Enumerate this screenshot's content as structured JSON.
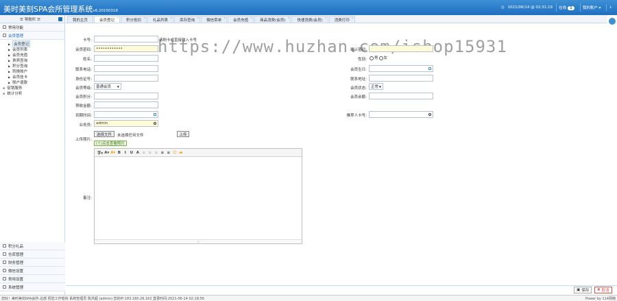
{
  "app": {
    "title": "美时美刻SPA会所管理系统",
    "version": "v6.20150318"
  },
  "topbar": {
    "datetime": "2021/06/14 @ 02:31:19",
    "online_label": "在线",
    "online_count": "1",
    "account_label": "我的账户 ▾",
    "down_icon": "↓"
  },
  "sidebar": {
    "header": "导航栏",
    "sections_top": [
      {
        "label": "常用功能",
        "icon": "grid-icon"
      },
      {
        "label": "会员管理",
        "icon": "grid-icon"
      }
    ],
    "tree": [
      {
        "label": "会员登记",
        "lvl": 1,
        "sel": true
      },
      {
        "label": "会员列表",
        "lvl": 1
      },
      {
        "label": "会员充值",
        "lvl": 1
      },
      {
        "label": "贵宾查询",
        "lvl": 1
      },
      {
        "label": "积分查询",
        "lvl": 1
      },
      {
        "label": "转换账户",
        "lvl": 1
      },
      {
        "label": "会员挂卡",
        "lvl": 1
      },
      {
        "label": "账户退款",
        "lvl": 1
      },
      {
        "label": "促销服务",
        "lvl": 0
      },
      {
        "label": "统计分析",
        "lvl": 0
      }
    ],
    "sections_bottom": [
      {
        "label": "积分礼品"
      },
      {
        "label": "仓库管理"
      },
      {
        "label": "财务管理"
      },
      {
        "label": "微信设置"
      },
      {
        "label": "常用设置"
      },
      {
        "label": "系统管理"
      }
    ]
  },
  "tabs": [
    "我的主页",
    "会员登记",
    "积分抵扣",
    "礼品列表",
    "库存查询",
    "微信菜单",
    "会员充值",
    "商品消费(会员)",
    "快速消费(会员)",
    "消费打印"
  ],
  "form": {
    "card_no": {
      "label": "卡号:",
      "hint": "请刷卡或直接输入卡号"
    },
    "password": {
      "label": "会员密码:",
      "value": "••••••••••••"
    },
    "name": {
      "label": "姓名:"
    },
    "phone": {
      "label": "联系电话:"
    },
    "sfz": {
      "label": "身份证号:"
    },
    "level": {
      "label": "会员等级:",
      "value": "普通会员"
    },
    "initial_points": {
      "label": "会员积分:"
    },
    "deposit": {
      "label": "预收金额:"
    },
    "expire": {
      "label": "到期时间:"
    },
    "operator": {
      "label": "业务员:",
      "value": "admin"
    },
    "upload": {
      "label": "上传照片:",
      "choose": "选择文件",
      "nofile": "未选择任何文件",
      "upload_btn": "上传",
      "tag": "(↑)点击查看照片"
    },
    "notes": {
      "label": "备注:"
    },
    "password_confirm": {
      "label": "确认密码:"
    },
    "gender": {
      "label": "性别:",
      "male": "男",
      "female": "女"
    },
    "birthday": {
      "label": "会员生日:"
    },
    "address": {
      "label": "联系地址:"
    },
    "status": {
      "label": "会员状态:",
      "value": "正常"
    },
    "sales_amount": {
      "label": "会员余额:"
    },
    "referrer": {
      "label": "推荐人卡号:"
    }
  },
  "editor": {
    "toolbar": [
      "字▾",
      "A▾",
      "A▾",
      "B",
      "I",
      "U",
      "A",
      "≡",
      "≡",
      "≡",
      "≡",
      "≡",
      "☺",
      "▬"
    ]
  },
  "actions": {
    "save": "保存",
    "cancel": "取消"
  },
  "status": {
    "left": "您好！美时美刻SPA会所-总部 祝您工作愉快 系统管理员 陈洪超 (admin) 您的IP:183.160.26.162 登录时间:2021-06-14 02:18:56",
    "right": "Power by 114网络"
  },
  "watermark": "https://www.huzhan.com/ishop15931"
}
